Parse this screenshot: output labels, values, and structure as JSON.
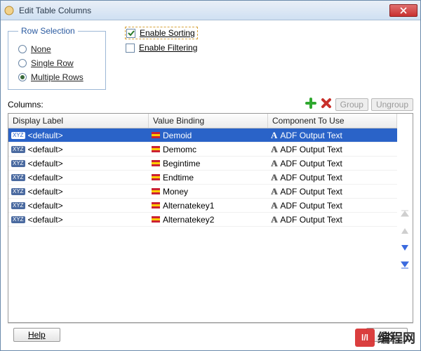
{
  "window": {
    "title": "Edit Table Columns",
    "close_icon": "x"
  },
  "row_selection": {
    "legend": "Row Selection",
    "options": [
      {
        "label": "None",
        "selected": false
      },
      {
        "label": "Single Row",
        "selected": false
      },
      {
        "label": "Multiple Rows",
        "selected": true
      }
    ]
  },
  "checkboxes": {
    "enable_sorting": {
      "label": "Enable Sorting",
      "checked": true,
      "highlight": true
    },
    "enable_filtering": {
      "label": "Enable Filtering",
      "checked": false,
      "highlight": false
    }
  },
  "columns_section": {
    "label": "Columns:",
    "buttons": {
      "add_icon": "+",
      "delete_icon": "x",
      "group_label": "Group",
      "ungroup_label": "Ungroup"
    }
  },
  "table": {
    "headers": {
      "display_label": "Display Label",
      "value_binding": "Value Binding",
      "component": "Component To Use"
    },
    "rows": [
      {
        "display": "<default>",
        "binding": "Demoid",
        "component": "ADF Output Text",
        "selected": true
      },
      {
        "display": "<default>",
        "binding": "Demomc",
        "component": "ADF Output Text",
        "selected": false
      },
      {
        "display": "<default>",
        "binding": "Begintime",
        "component": "ADF Output Text",
        "selected": false
      },
      {
        "display": "<default>",
        "binding": "Endtime",
        "component": "ADF Output Text",
        "selected": false
      },
      {
        "display": "<default>",
        "binding": "Money",
        "component": "ADF Output Text",
        "selected": false
      },
      {
        "display": "<default>",
        "binding": "Alternatekey1",
        "component": "ADF Output Text",
        "selected": false
      },
      {
        "display": "<default>",
        "binding": "Alternatekey2",
        "component": "ADF Output Text",
        "selected": false
      }
    ]
  },
  "side_arrows": {
    "top": "⇑",
    "up": "↑",
    "down": "↓",
    "bottom": "⇓"
  },
  "bottom": {
    "help_label": "Help",
    "ok_label": "OK"
  },
  "watermark": {
    "logo": "l/l",
    "text": "编程网"
  }
}
